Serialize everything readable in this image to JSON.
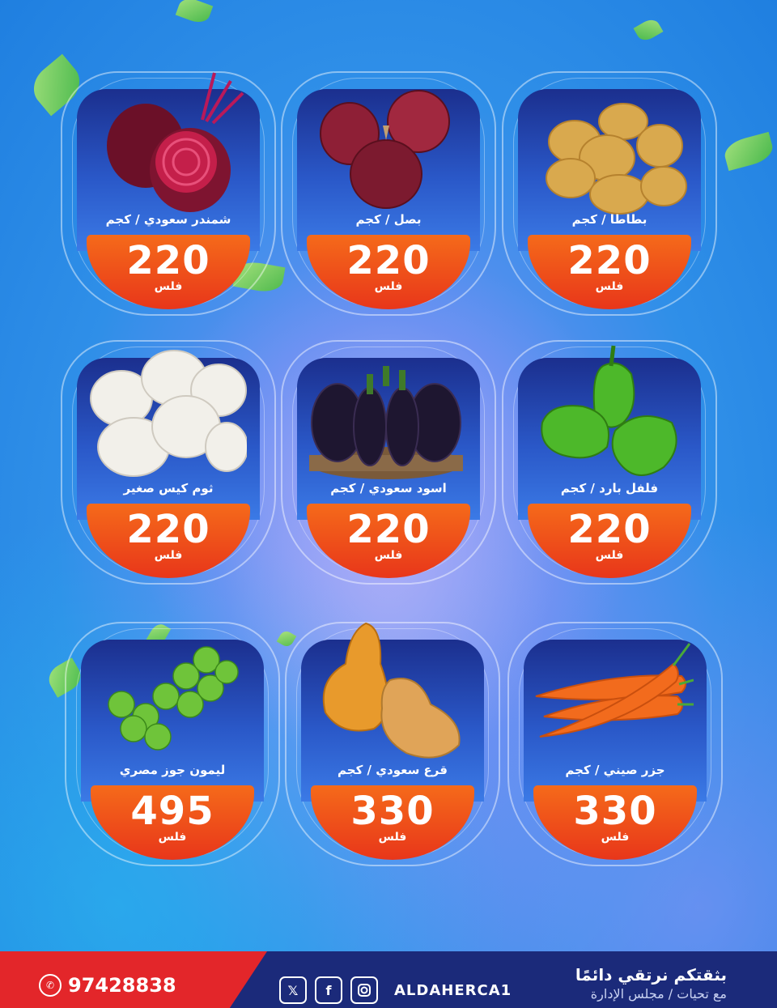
{
  "products": [
    {
      "name": "بطاطا / كجم",
      "price": "220",
      "unit": "فلس",
      "icon": "potato-icon"
    },
    {
      "name": "بصل / كجم",
      "price": "220",
      "unit": "فلس",
      "icon": "onion-icon"
    },
    {
      "name": "شمندر سعودي / كجم",
      "price": "220",
      "unit": "فلس",
      "icon": "beet-icon"
    },
    {
      "name": "فلفل بارد / كجم",
      "price": "220",
      "unit": "فلس",
      "icon": "pepper-icon"
    },
    {
      "name": "اسود سعودي / كجم",
      "price": "220",
      "unit": "فلس",
      "icon": "eggplant-icon"
    },
    {
      "name": "ثوم كيس صغير",
      "price": "220",
      "unit": "فلس",
      "icon": "garlic-icon"
    },
    {
      "name": "جزر صيني / كجم",
      "price": "330",
      "unit": "فلس",
      "icon": "carrot-icon"
    },
    {
      "name": "قرع سعودي / كجم",
      "price": "330",
      "unit": "فلس",
      "icon": "squash-icon"
    },
    {
      "name": "ليمون جوز مصري",
      "price": "495",
      "unit": "فلس",
      "icon": "lime-bag-icon"
    }
  ],
  "footer": {
    "phone": "97428838",
    "handle": "ALDAHERCA1",
    "slogan_line1": "بثقتكم نرتقي دائمًا",
    "slogan_line2": "مع تحيات / مجلس الإدارة",
    "social_icons": [
      "x-icon",
      "facebook-icon",
      "instagram-icon"
    ]
  }
}
